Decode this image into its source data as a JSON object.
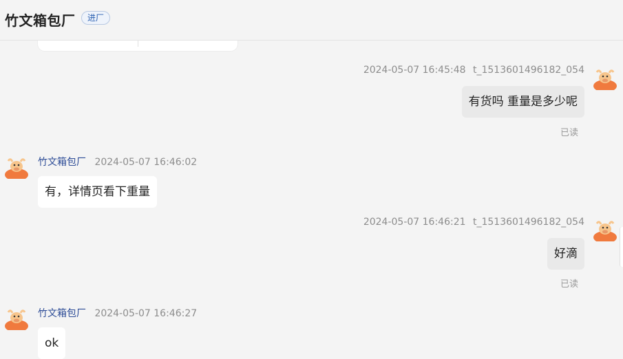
{
  "header": {
    "title": "竹文箱包厂",
    "badge": "进厂"
  },
  "messages": [
    {
      "direction": "out",
      "time": "2024-05-07 16:45:48",
      "sender": "t_1513601496182_054",
      "text": "有货吗 重量是多少呢",
      "status": "已读"
    },
    {
      "direction": "in",
      "time": "2024-05-07 16:46:02",
      "sender": "竹文箱包厂",
      "text": "有，详情页看下重量"
    },
    {
      "direction": "out",
      "time": "2024-05-07 16:46:21",
      "sender": "t_1513601496182_054",
      "text": "好滴",
      "status": "已读"
    },
    {
      "direction": "in",
      "time": "2024-05-07 16:46:27",
      "sender": "竹文箱包厂",
      "text": "ok"
    }
  ],
  "colors": {
    "background": "#f4f4f4",
    "sender_name": "#2c4b96",
    "badge_text": "#2a5fb0",
    "avatar": "#f07a3e"
  }
}
